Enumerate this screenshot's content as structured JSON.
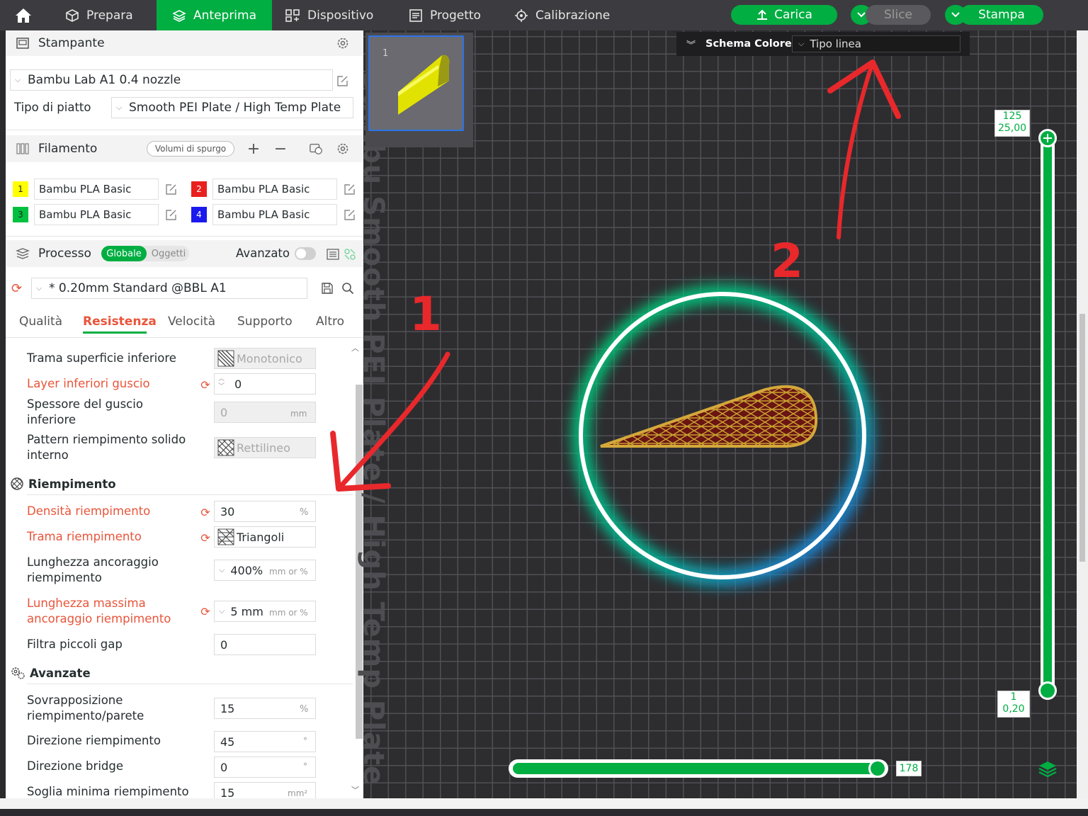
{
  "topbar": {
    "tabs": [
      "Prepara",
      "Anteprima",
      "Dispositivo",
      "Progetto",
      "Calibrazione"
    ],
    "active_tab": "Anteprima",
    "carica": "Carica",
    "slice": "Slice",
    "stampa": "Stampa"
  },
  "printer": {
    "header": "Stampante",
    "name": "Bambu Lab A1 0.4 nozzle",
    "plate_label": "Tipo di piatto",
    "plate_value": "Smooth PEI Plate / High Temp Plate"
  },
  "filament": {
    "header": "Filamento",
    "purge": "Volumi di spurgo",
    "items": [
      {
        "num": "1",
        "name": "Bambu PLA Basic",
        "color": "#ffff00"
      },
      {
        "num": "2",
        "name": "Bambu PLA Basic",
        "color": "#e8201e"
      },
      {
        "num": "3",
        "name": "Bambu PLA Basic",
        "color": "#00c040"
      },
      {
        "num": "4",
        "name": "Bambu PLA Basic",
        "color": "#1a1aee"
      }
    ]
  },
  "process": {
    "header": "Processo",
    "toggle_global": "Globale",
    "toggle_objects": "Oggetti",
    "advanced": "Avanzato",
    "preset": "* 0.20mm Standard @BBL A1",
    "tabs": [
      "Qualità",
      "Resistenza",
      "Velocità",
      "Supporto",
      "Altro"
    ],
    "active_tab": "Resistenza"
  },
  "settings": {
    "bottom_pattern_label": "Trama superficie inferiore",
    "bottom_pattern_value": "Monotonico",
    "bottom_layers_label": "Layer inferiori guscio",
    "bottom_layers_value": "0",
    "bottom_thickness_label_1": "Spessore del guscio",
    "bottom_thickness_label_2": "inferiore",
    "bottom_thickness_value": "0",
    "bottom_thickness_unit": "mm",
    "solid_infill_label_1": "Pattern riempimento solido",
    "solid_infill_label_2": "interno",
    "solid_infill_value": "Rettilineo",
    "infill_group": "Riempimento",
    "infill_density_label": "Densità riempimento",
    "infill_density_value": "30",
    "infill_density_unit": "%",
    "infill_pattern_label": "Trama riempimento",
    "infill_pattern_value": "Triangoli",
    "anchor_label_1": "Lunghezza ancoraggio",
    "anchor_label_2": "riempimento",
    "anchor_value": "400%",
    "anchor_unit": "mm or %",
    "anchor_max_label_1": "Lunghezza massima",
    "anchor_max_label_2": "ancoraggio riempimento",
    "anchor_max_value": "5 mm",
    "anchor_max_unit": "mm or %",
    "gap_label": "Filtra piccoli gap",
    "gap_value": "0",
    "advanced_group": "Avanzate",
    "overlap_label_1": "Sovrapposizione",
    "overlap_label_2": "riempimento/parete",
    "overlap_value": "15",
    "overlap_unit": "%",
    "direction_label": "Direzione riempimento",
    "direction_value": "45",
    "direction_unit": "°",
    "bridge_label": "Direzione bridge",
    "bridge_value": "0",
    "bridge_unit": "°",
    "min_infill_label": "Soglia minima riempimento",
    "min_infill_value": "15",
    "min_infill_unit": "mm²"
  },
  "viewport": {
    "plate_number": "1",
    "plate_text": "Bambu Smooth PEI Plate / High Temp Plate",
    "scheme_label": "Schema Colore",
    "scheme_value": "Tipo linea",
    "layer_top": "125",
    "height_top": "25,00",
    "layer_bottom": "1",
    "height_bottom": "0,20",
    "move_value": "178"
  },
  "annotations": {
    "n1": "1",
    "n2": "2"
  }
}
